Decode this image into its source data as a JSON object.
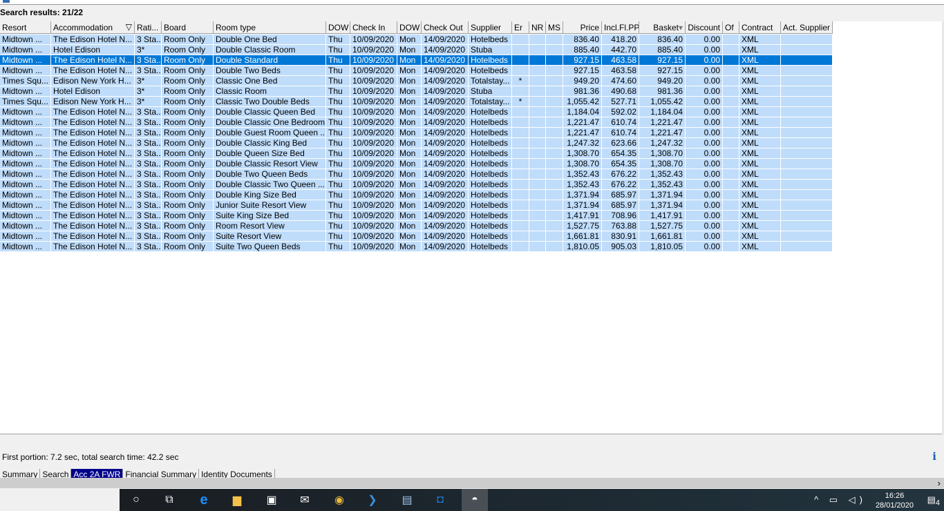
{
  "title": "Search results: 21/22",
  "columns": [
    "Resort",
    "Accommodation",
    "Rati...",
    "Board",
    "Room type",
    "DOW",
    "Check In",
    "DOW",
    "Check Out",
    "Supplier",
    "Er",
    "NR",
    "MS",
    "Price",
    "Incl.Fl.PP",
    "Basket",
    "Discount",
    "Of",
    "Contract",
    "Act. Supplier"
  ],
  "selected_row": 2,
  "rows": [
    [
      "Midtown ...",
      "The Edison Hotel N...",
      "3 Sta...",
      "Room Only",
      "Double One Bed",
      "Thu",
      "10/09/2020",
      "Mon",
      "14/09/2020",
      "Hotelbeds",
      "",
      "",
      "",
      "836.40",
      "418.20",
      "836.40",
      "0.00",
      "",
      "XML",
      ""
    ],
    [
      "Midtown ...",
      "Hotel Edison",
      "3*",
      "Room Only",
      "Double Classic Room",
      "Thu",
      "10/09/2020",
      "Mon",
      "14/09/2020",
      "Stuba",
      "",
      "",
      "",
      "885.40",
      "442.70",
      "885.40",
      "0.00",
      "",
      "XML",
      ""
    ],
    [
      "Midtown ...",
      "The Edison Hotel N...",
      "3 Sta...",
      "Room Only",
      "Double Standard",
      "Thu",
      "10/09/2020",
      "Mon",
      "14/09/2020",
      "Hotelbeds",
      "",
      "",
      "",
      "927.15",
      "463.58",
      "927.15",
      "0.00",
      "",
      "XML",
      ""
    ],
    [
      "Midtown ...",
      "The Edison Hotel N...",
      "3 Sta...",
      "Room Only",
      "Double Two Beds",
      "Thu",
      "10/09/2020",
      "Mon",
      "14/09/2020",
      "Hotelbeds",
      "",
      "",
      "",
      "927.15",
      "463.58",
      "927.15",
      "0.00",
      "",
      "XML",
      ""
    ],
    [
      "Times Squ...",
      "Edison New York H...",
      "3*",
      "Room Only",
      "Classic One Bed",
      "Thu",
      "10/09/2020",
      "Mon",
      "14/09/2020",
      "Totalstay...",
      "*",
      "",
      "",
      "949.20",
      "474.60",
      "949.20",
      "0.00",
      "",
      "XML",
      ""
    ],
    [
      "Midtown ...",
      "Hotel Edison",
      "3*",
      "Room Only",
      "Classic Room",
      "Thu",
      "10/09/2020",
      "Mon",
      "14/09/2020",
      "Stuba",
      "",
      "",
      "",
      "981.36",
      "490.68",
      "981.36",
      "0.00",
      "",
      "XML",
      ""
    ],
    [
      "Times Squ...",
      "Edison New York H...",
      "3*",
      "Room Only",
      "Classic Two Double Beds",
      "Thu",
      "10/09/2020",
      "Mon",
      "14/09/2020",
      "Totalstay...",
      "*",
      "",
      "",
      "1,055.42",
      "527.71",
      "1,055.42",
      "0.00",
      "",
      "XML",
      ""
    ],
    [
      "Midtown ...",
      "The Edison Hotel N...",
      "3 Sta...",
      "Room Only",
      "Double Classic Queen Bed",
      "Thu",
      "10/09/2020",
      "Mon",
      "14/09/2020",
      "Hotelbeds",
      "",
      "",
      "",
      "1,184.04",
      "592.02",
      "1,184.04",
      "0.00",
      "",
      "XML",
      ""
    ],
    [
      "Midtown ...",
      "The Edison Hotel N...",
      "3 Sta...",
      "Room Only",
      "Double Classic One Bedroom",
      "Thu",
      "10/09/2020",
      "Mon",
      "14/09/2020",
      "Hotelbeds",
      "",
      "",
      "",
      "1,221.47",
      "610.74",
      "1,221.47",
      "0.00",
      "",
      "XML",
      ""
    ],
    [
      "Midtown ...",
      "The Edison Hotel N...",
      "3 Sta...",
      "Room Only",
      "Double Guest Room Queen ...",
      "Thu",
      "10/09/2020",
      "Mon",
      "14/09/2020",
      "Hotelbeds",
      "",
      "",
      "",
      "1,221.47",
      "610.74",
      "1,221.47",
      "0.00",
      "",
      "XML",
      ""
    ],
    [
      "Midtown ...",
      "The Edison Hotel N...",
      "3 Sta...",
      "Room Only",
      "Double Classic King Bed",
      "Thu",
      "10/09/2020",
      "Mon",
      "14/09/2020",
      "Hotelbeds",
      "",
      "",
      "",
      "1,247.32",
      "623.66",
      "1,247.32",
      "0.00",
      "",
      "XML",
      ""
    ],
    [
      "Midtown ...",
      "The Edison Hotel N...",
      "3 Sta...",
      "Room Only",
      "Double Queen Size Bed",
      "Thu",
      "10/09/2020",
      "Mon",
      "14/09/2020",
      "Hotelbeds",
      "",
      "",
      "",
      "1,308.70",
      "654.35",
      "1,308.70",
      "0.00",
      "",
      "XML",
      ""
    ],
    [
      "Midtown ...",
      "The Edison Hotel N...",
      "3 Sta...",
      "Room Only",
      "Double Classic Resort View",
      "Thu",
      "10/09/2020",
      "Mon",
      "14/09/2020",
      "Hotelbeds",
      "",
      "",
      "",
      "1,308.70",
      "654.35",
      "1,308.70",
      "0.00",
      "",
      "XML",
      ""
    ],
    [
      "Midtown ...",
      "The Edison Hotel N...",
      "3 Sta...",
      "Room Only",
      "Double Two Queen Beds",
      "Thu",
      "10/09/2020",
      "Mon",
      "14/09/2020",
      "Hotelbeds",
      "",
      "",
      "",
      "1,352.43",
      "676.22",
      "1,352.43",
      "0.00",
      "",
      "XML",
      ""
    ],
    [
      "Midtown ...",
      "The Edison Hotel N...",
      "3 Sta...",
      "Room Only",
      "Double Classic Two Queen ...",
      "Thu",
      "10/09/2020",
      "Mon",
      "14/09/2020",
      "Hotelbeds",
      "",
      "",
      "",
      "1,352.43",
      "676.22",
      "1,352.43",
      "0.00",
      "",
      "XML",
      ""
    ],
    [
      "Midtown ...",
      "The Edison Hotel N...",
      "3 Sta...",
      "Room Only",
      "Double King Size Bed",
      "Thu",
      "10/09/2020",
      "Mon",
      "14/09/2020",
      "Hotelbeds",
      "",
      "",
      "",
      "1,371.94",
      "685.97",
      "1,371.94",
      "0.00",
      "",
      "XML",
      ""
    ],
    [
      "Midtown ...",
      "The Edison Hotel N...",
      "3 Sta...",
      "Room Only",
      "Junior Suite Resort View",
      "Thu",
      "10/09/2020",
      "Mon",
      "14/09/2020",
      "Hotelbeds",
      "",
      "",
      "",
      "1,371.94",
      "685.97",
      "1,371.94",
      "0.00",
      "",
      "XML",
      ""
    ],
    [
      "Midtown ...",
      "The Edison Hotel N...",
      "3 Sta...",
      "Room Only",
      "Suite King Size Bed",
      "Thu",
      "10/09/2020",
      "Mon",
      "14/09/2020",
      "Hotelbeds",
      "",
      "",
      "",
      "1,417.91",
      "708.96",
      "1,417.91",
      "0.00",
      "",
      "XML",
      ""
    ],
    [
      "Midtown ...",
      "The Edison Hotel N...",
      "3 Sta...",
      "Room Only",
      "Room Resort View",
      "Thu",
      "10/09/2020",
      "Mon",
      "14/09/2020",
      "Hotelbeds",
      "",
      "",
      "",
      "1,527.75",
      "763.88",
      "1,527.75",
      "0.00",
      "",
      "XML",
      ""
    ],
    [
      "Midtown ...",
      "The Edison Hotel N...",
      "3 Sta...",
      "Room Only",
      "Suite Resort View",
      "Thu",
      "10/09/2020",
      "Mon",
      "14/09/2020",
      "Hotelbeds",
      "",
      "",
      "",
      "1,661.81",
      "830.91",
      "1,661.81",
      "0.00",
      "",
      "XML",
      ""
    ],
    [
      "Midtown ...",
      "The Edison Hotel N...",
      "3 Sta...",
      "Room Only",
      "Suite Two Queen Beds",
      "Thu",
      "10/09/2020",
      "Mon",
      "14/09/2020",
      "Hotelbeds",
      "",
      "",
      "",
      "1,810.05",
      "905.03",
      "1,810.05",
      "0.00",
      "",
      "XML",
      ""
    ]
  ],
  "status": "First portion: 7.2 sec, total search time: 42.2 sec",
  "tabs": [
    {
      "label": "Summary"
    },
    {
      "label": "Search"
    },
    {
      "label": "Acc 2A FWR",
      "active": true
    },
    {
      "label": "Financial Summary"
    },
    {
      "label": "Identity Documents"
    }
  ],
  "taskbar": {
    "time": "16:26",
    "date": "28/01/2020",
    "notifications": "4"
  }
}
